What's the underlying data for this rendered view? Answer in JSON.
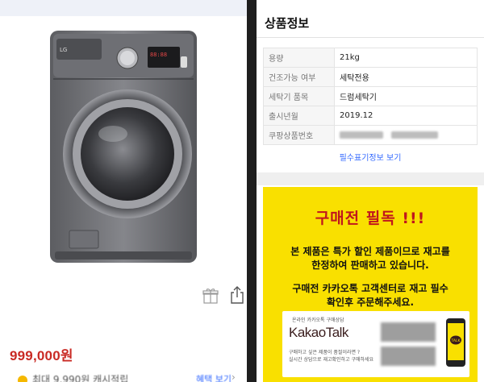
{
  "left": {
    "price": "999,000원",
    "reward_text": "최대 9,990원 캐시적립",
    "reward_link": "혜택 보기"
  },
  "right": {
    "section_title": "상품정보",
    "specs": [
      {
        "key": "용량",
        "value": "21kg"
      },
      {
        "key": "건조가능 여부",
        "value": "세탁전용"
      },
      {
        "key": "세탁기 품목",
        "value": "드럼세탁기"
      },
      {
        "key": "출시년월",
        "value": "2019.12"
      },
      {
        "key": "쿠팡상품번호",
        "value": ""
      }
    ],
    "info_link": "필수표기정보 보기"
  },
  "notice": {
    "title": "구매전 필독 !!!",
    "lines_a": [
      "본 제품은 특가 할인 제품이므로 재고를",
      "한정하여 판매하고 있습니다."
    ],
    "lines_b": [
      "구매전 카카오톡 고객센터로 재고 필수",
      "확인후 주문해주세요."
    ],
    "kakao_small": "온라인 카카오톡 구매상담",
    "kakao_logo": "KakaoTalk",
    "kakao_desc_1": "구매하고 싶은 제품이 품절이라면 ?",
    "kakao_desc_2": "실시간 상담으로 재고확인하고 구매하세요"
  },
  "colors": {
    "price_red": "#c92a24",
    "link_blue": "#346aff",
    "notice_yellow": "#f9e000",
    "notice_title_red": "#c0161d"
  },
  "icons": [
    "gift-icon",
    "share-icon",
    "coin-icon",
    "chevron-right-icon",
    "kakao-phone-icon"
  ]
}
